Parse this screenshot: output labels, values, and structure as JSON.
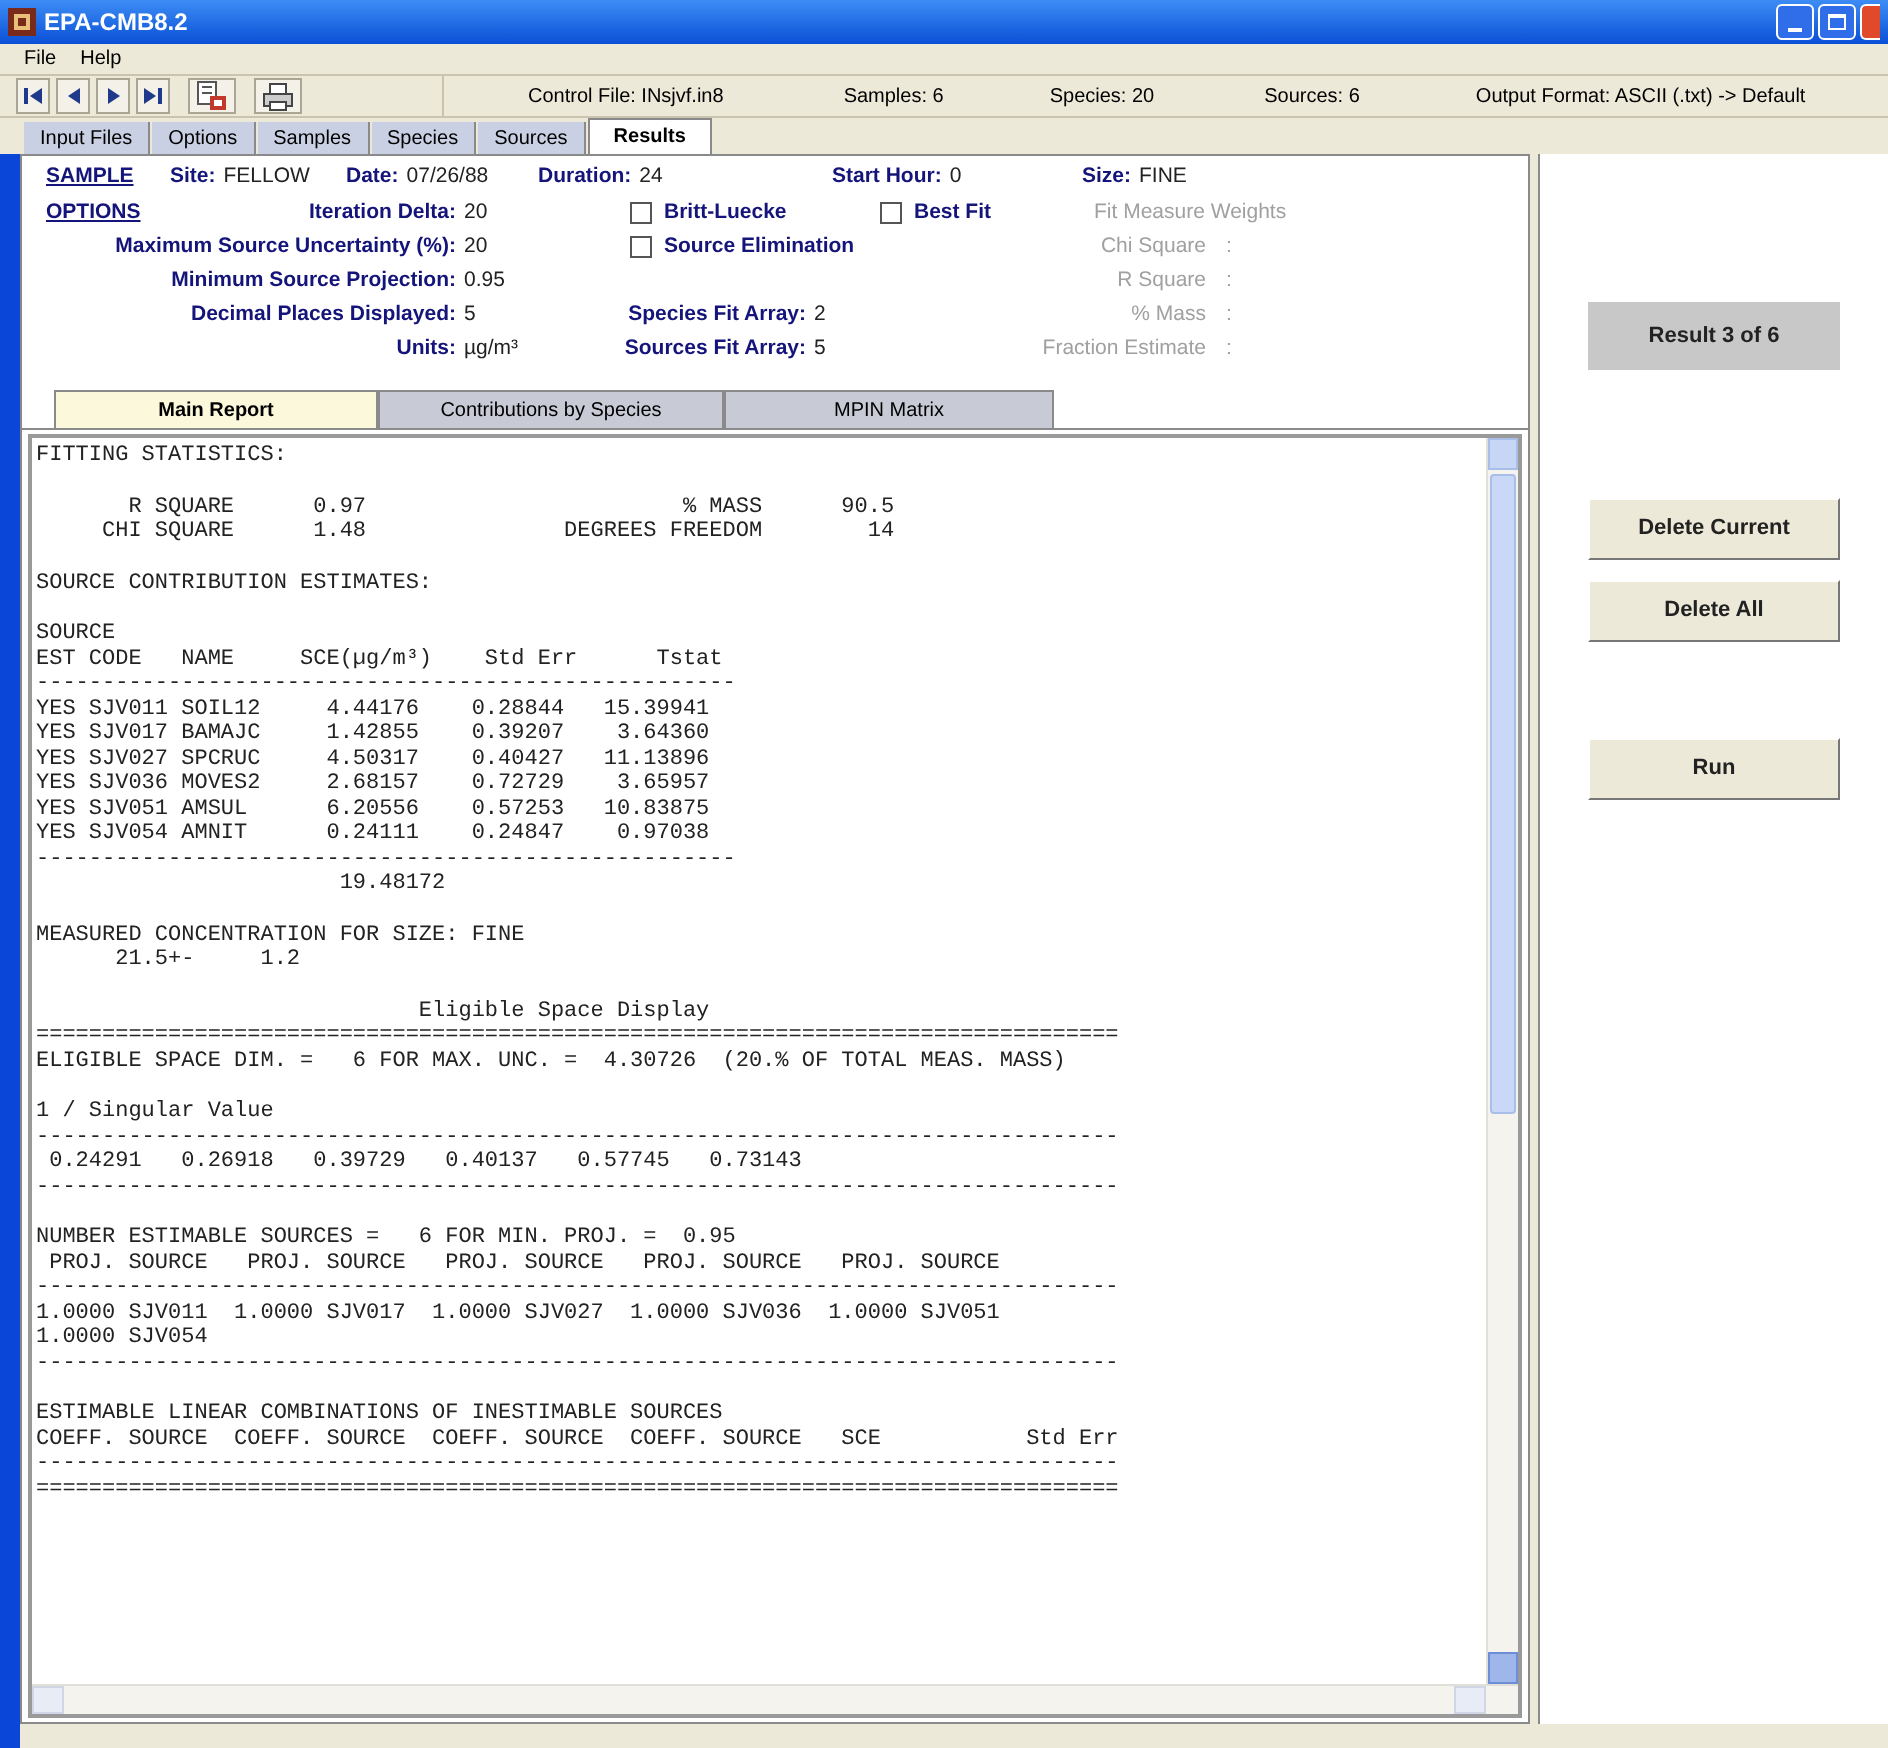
{
  "window": {
    "title": "EPA-CMB8.2"
  },
  "menu": [
    "File",
    "Help"
  ],
  "toolbar": {
    "buttons": [
      {
        "kind": "first"
      },
      {
        "kind": "previous"
      },
      {
        "kind": "next"
      },
      {
        "kind": "last"
      },
      {
        "kind": "report"
      },
      {
        "kind": "print"
      }
    ],
    "info": [
      "Control File: INsjvf.in8",
      "Samples: 6",
      "Species: 20",
      "Sources: 6",
      "Output Format: ASCII (.txt) -> Default"
    ]
  },
  "tabs": [
    {
      "label": "Input Files",
      "selected": false
    },
    {
      "label": "Options",
      "selected": false
    },
    {
      "label": "Samples",
      "selected": false
    },
    {
      "label": "Species",
      "selected": false
    },
    {
      "label": "Sources",
      "selected": false
    },
    {
      "label": "Results",
      "selected": true
    }
  ],
  "sample": {
    "heading": "SAMPLE",
    "fields": [
      {
        "label": "Site:",
        "value": "FELLOW"
      },
      {
        "label": "Date:",
        "value": "07/26/88"
      },
      {
        "label": "Duration:",
        "value": "24"
      },
      {
        "label": "Start Hour:",
        "value": "0"
      },
      {
        "label": "Size:",
        "value": "FINE"
      }
    ]
  },
  "options": {
    "heading": "OPTIONS",
    "settings": [
      {
        "label": "Iteration Delta:",
        "value": "20"
      },
      {
        "label": "Maximum Source Uncertainty (%):",
        "value": "20"
      },
      {
        "label": "Minimum Source Projection:",
        "value": "0.95"
      },
      {
        "label": "Decimal Places Displayed:",
        "value": "5"
      },
      {
        "label": "Units:",
        "value": "µg/m³"
      }
    ],
    "checkboxes": [
      {
        "label": "Britt-Luecke",
        "checked": false
      },
      {
        "label": "Best Fit",
        "checked": false
      },
      {
        "label": "Source Elimination",
        "checked": false
      }
    ],
    "fit_arrays": [
      {
        "label": "Species Fit Array:",
        "value": "2"
      },
      {
        "label": "Sources Fit Array:",
        "value": "5"
      }
    ],
    "weights": {
      "title": "Fit Measure Weights",
      "items": [
        {
          "label": "Chi Square",
          "value": ":"
        },
        {
          "label": "R Square",
          "value": ":"
        },
        {
          "label": "% Mass",
          "value": ":"
        },
        {
          "label": "Fraction Estimate",
          "value": ":"
        }
      ]
    }
  },
  "report_tabs": [
    {
      "label": "Main Report",
      "selected": true
    },
    {
      "label": "Contributions by Species",
      "selected": false
    },
    {
      "label": "MPIN Matrix",
      "selected": false
    }
  ],
  "report": {
    "blocks": [
      [
        "FITTING STATISTICS:"
      ],
      [
        "       R SQUARE      0.97                        % MASS      90.5",
        "     CHI SQUARE      1.48               DEGREES FREEDOM        14"
      ],
      [
        "SOURCE CONTRIBUTION ESTIMATES:"
      ],
      [
        "SOURCE",
        "EST CODE   NAME     SCE(µg/m³)    Std Err      Tstat",
        "-----------------------------------------------------",
        "YES SJV011 SOIL12     4.44176    0.28844   15.39941",
        "YES SJV017 BAMAJC     1.42855    0.39207    3.64360",
        "YES SJV027 SPCRUC     4.50317    0.40427   11.13896",
        "YES SJV036 MOVES2     2.68157    0.72729    3.65957",
        "YES SJV051 AMSUL      6.20556    0.57253   10.83875",
        "YES SJV054 AMNIT      0.24111    0.24847    0.97038",
        "-----------------------------------------------------",
        "                       19.48172"
      ],
      [
        "MEASURED CONCENTRATION FOR SIZE: FINE",
        "      21.5+-     1.2"
      ],
      [
        "                             Eligible Space Display",
        "==================================================================================",
        "ELIGIBLE SPACE DIM. =   6 FOR MAX. UNC. =  4.30726  (20.% OF TOTAL MEAS. MASS)"
      ],
      [
        "1 / Singular Value",
        "----------------------------------------------------------------------------------",
        " 0.24291   0.26918   0.39729   0.40137   0.57745   0.73143",
        "----------------------------------------------------------------------------------"
      ],
      [
        "NUMBER ESTIMABLE SOURCES =   6 FOR MIN. PROJ. =  0.95",
        " PROJ. SOURCE   PROJ. SOURCE   PROJ. SOURCE   PROJ. SOURCE   PROJ. SOURCE",
        "----------------------------------------------------------------------------------",
        "1.0000 SJV011  1.0000 SJV017  1.0000 SJV027  1.0000 SJV036  1.0000 SJV051",
        "1.0000 SJV054",
        "----------------------------------------------------------------------------------"
      ],
      [
        "ESTIMABLE LINEAR COMBINATIONS OF INESTIMABLE SOURCES",
        "COEFF. SOURCE  COEFF. SOURCE  COEFF. SOURCE  COEFF. SOURCE   SCE           Std Err",
        "----------------------------------------------------------------------------------",
        "=================================================================================="
      ]
    ]
  },
  "result_label": "Result 3 of 6",
  "buttons": [
    "Delete Current",
    "Delete All",
    "Run"
  ]
}
